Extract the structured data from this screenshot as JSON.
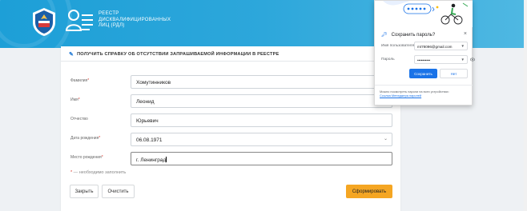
{
  "header": {
    "brand_line1": "РЕЕСТР",
    "brand_line2": "ДИСКВАЛИФИЦИРОВАННЫХ",
    "brand_line3": "ЛИЦ (РДЛ)"
  },
  "form": {
    "title": "ПОЛУЧИТЬ СПРАВКУ ОБ ОТСУТСТВИИ ЗАПРАШИВАЕМОЙ ИНФОРМАЦИИ В РЕЕСТРЕ",
    "required_mark": "*",
    "fields": [
      {
        "label": "Фамилия",
        "required": "*",
        "value": "Хомутинников"
      },
      {
        "label": "Имя",
        "required": "*",
        "value": "Леонид"
      },
      {
        "label": "Отчество",
        "required": "",
        "value": "Юрьевич"
      },
      {
        "label": "Дата рождения",
        "required": "*",
        "value": "06.08.1971"
      },
      {
        "label": "Место рождения",
        "required": "*",
        "value": "г. Ленинград"
      }
    ],
    "note_mark": "*",
    "note_text": " — необходимо заполнить",
    "close_label": "Закрыть",
    "clear_label": "Очистить",
    "submit_label": "Сформировать"
  },
  "password_popup": {
    "title": "Сохранить пароль?",
    "username_label": "Имя пользователя",
    "username_value": "mt78096@gmail.com",
    "password_label": "Пароль",
    "password_value": "••••••••••",
    "save_label": "Сохранить",
    "never_label": "Нет",
    "footer_text": "Можно посмотреть пароли на всех устройствах:",
    "footer_link": "Ссылка Менеджера паролей"
  }
}
